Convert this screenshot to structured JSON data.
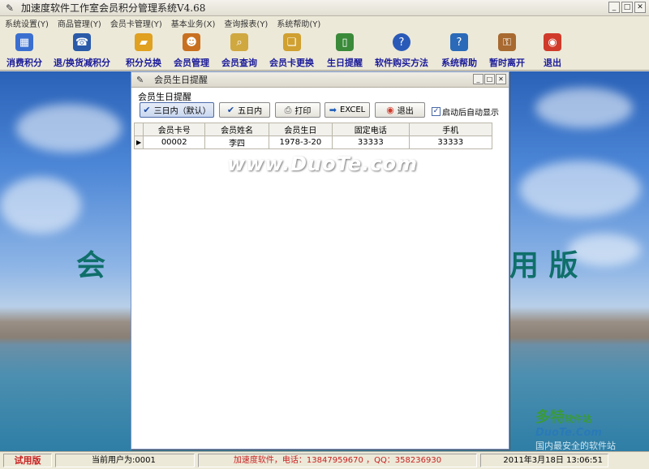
{
  "window": {
    "title": "加速度软件工作室会员积分管理系统V4.68"
  },
  "menu": [
    "系统设置(Y)",
    "商品管理(Y)",
    "会员卡管理(Y)",
    "基本业务(X)",
    "查询报表(Y)",
    "系统帮助(Y)"
  ],
  "toolbar": [
    {
      "label": "消费积分",
      "icon": "calculator-icon",
      "color": "#3a6fd0"
    },
    {
      "label": "退/换货减积分",
      "icon": "phone-icon",
      "color": "#2a5aa8"
    },
    {
      "label": "积分兑换",
      "icon": "folder-icon",
      "color": "#e0a020"
    },
    {
      "label": "会员管理",
      "icon": "users-icon",
      "color": "#c87020"
    },
    {
      "label": "会员查询",
      "icon": "search-icon",
      "color": "#d0a840"
    },
    {
      "label": "会员卡更换",
      "icon": "book-icon",
      "color": "#d0a030"
    },
    {
      "label": "生日提醒",
      "icon": "cellphone-icon",
      "color": "#3a8a3a"
    },
    {
      "label": "软件购买方法",
      "icon": "help-icon",
      "color": "#2a5ab8"
    },
    {
      "label": "系统帮助",
      "icon": "help-book-icon",
      "color": "#2a6ab8"
    },
    {
      "label": "暂时离开",
      "icon": "lock-icon",
      "color": "#a86a30"
    },
    {
      "label": "退出",
      "icon": "exit-icon",
      "color": "#d03a2a"
    }
  ],
  "dialog": {
    "title": "会员生日提醒",
    "group_label": "会员生日提醒",
    "buttons": [
      {
        "label": "三日内（默认）",
        "icon": "check-icon"
      },
      {
        "label": "五日内",
        "icon": "check-icon"
      },
      {
        "label": "打印",
        "icon": "printer-icon"
      },
      {
        "label": "EXCEL",
        "icon": "arrow-right-icon"
      },
      {
        "label": "退出",
        "icon": "exit-icon"
      }
    ],
    "auto_show_label": "启动后自动显示",
    "auto_show_checked": true,
    "columns": [
      "会员卡号",
      "会员姓名",
      "会员生日",
      "固定电话",
      "手机"
    ],
    "rows": [
      [
        "00002",
        "李四",
        "1978-3-20",
        "33333",
        "33333"
      ]
    ]
  },
  "watermarks": {
    "left_char": "会",
    "right_chars": "用 版",
    "center": "www.DuoTe.com",
    "logo_line1": "多特",
    "logo_line1_small": "软件站",
    "logo_line2": "DuoTe.Com",
    "logo_line3": "国内最安全的软件站"
  },
  "status": {
    "trial": "试用版",
    "user": "当前用户为:0001",
    "company": "加速度软件，电话：13847959670 ，QQ：358236930",
    "datetime": "2011年3月18日   13:06:51"
  }
}
